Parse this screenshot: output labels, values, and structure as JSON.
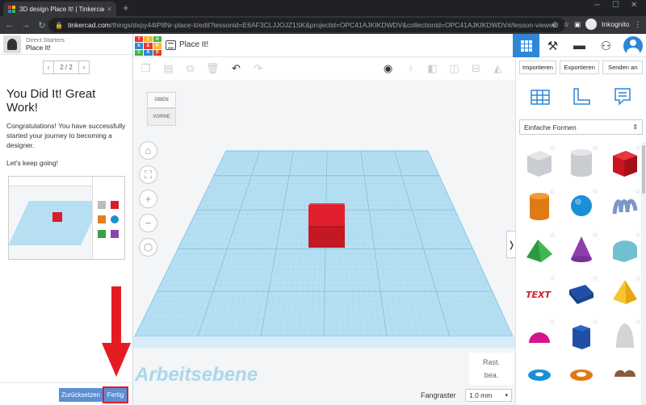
{
  "browser": {
    "tab_title": "3D design Place It! | Tinkercad",
    "tab_close": "×",
    "new_tab": "+",
    "url_host": "tinkercad.com",
    "url_path": "/things/dxpy44tP8Nr-place-it/edit?lessonid=E6AF3CLJJOJZ1SK&projectid=OPC41AJKIKDWDV&collectionid=OPC41AJKIKDWDV#/lesson-viewer",
    "incognito_label": "Inkognito",
    "nav_back": "←",
    "nav_forward": "→",
    "nav_reload": "↻"
  },
  "lesson": {
    "series": "Direct Starters",
    "name": "Place It!",
    "pager_prev": "‹",
    "pager_label": "2 / 2",
    "pager_next": "›",
    "heading": "You Did It! Great Work!",
    "paragraph1": "Congratulations! You have successfully started your journey to becoming a designer.",
    "paragraph2": "Let's keep going!",
    "back_label": "Zurücksetzen",
    "done_label": "Fertig"
  },
  "app": {
    "design_title": "Place It!",
    "logo_letters": [
      "TIN",
      "KER",
      "CAD"
    ]
  },
  "viewcube": {
    "top": "OBEN",
    "front": "VORNE"
  },
  "workplane": {
    "label": "Arbeitsebene",
    "snap_label": "Fangraster",
    "snap_value": "1.0 mm",
    "rast_line1": "Rast.",
    "rast_line2": "bea."
  },
  "shapes_panel": {
    "import_label": "Importieren",
    "export_label": "Exportieren",
    "send_label": "Senden an",
    "library_value": "Einfache Formen"
  },
  "colors": {
    "accent": "#2e86d6",
    "workplane": "#b6dff2",
    "box": "#d81e2c",
    "arrow": "#e51b23"
  }
}
